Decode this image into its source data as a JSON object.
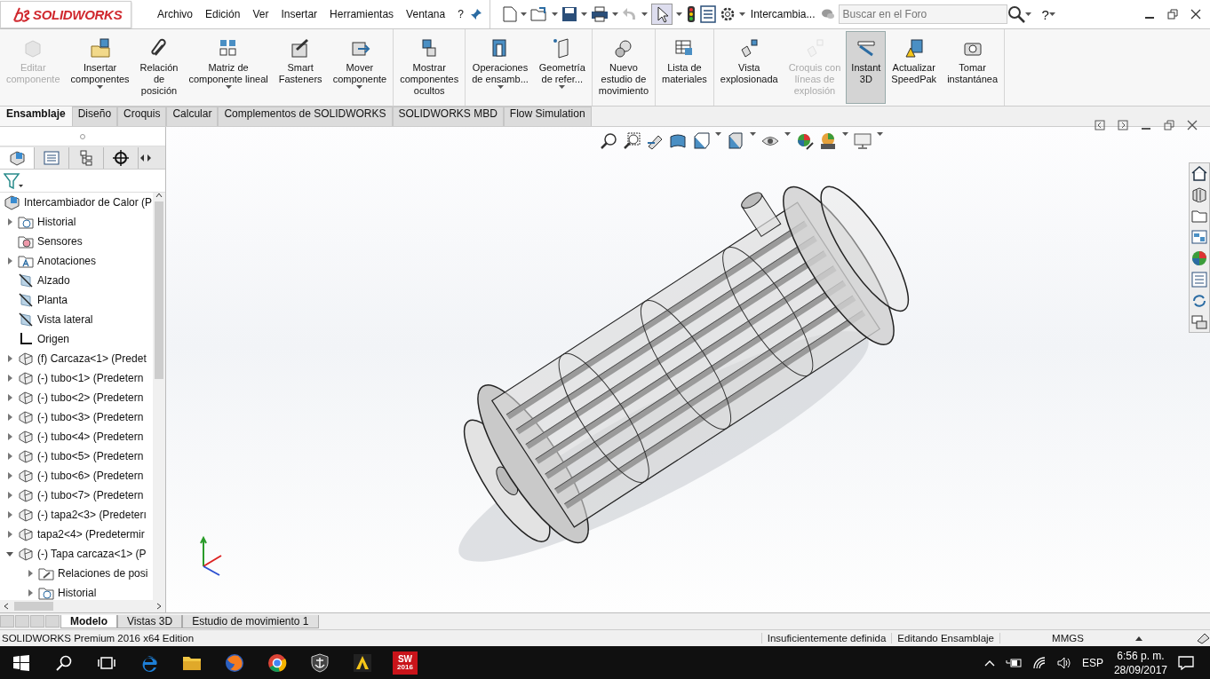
{
  "app": {
    "logo": "SOLIDWORKS",
    "menu": [
      "Archivo",
      "Edición",
      "Ver",
      "Insertar",
      "Herramientas",
      "Ventana",
      "?"
    ],
    "document_title": "Intercambia...",
    "search": {
      "placeholder": "Buscar en el Foro"
    },
    "help": "?"
  },
  "ribbon": {
    "groups": [
      [
        {
          "label": "Editar\ncomponente",
          "disabled": true,
          "selected": false,
          "dropdown": false
        },
        {
          "label": "Insertar\ncomponentes",
          "disabled": false,
          "selected": false,
          "dropdown": true
        },
        {
          "label": "Relación\nde\nposición",
          "disabled": false,
          "selected": false,
          "dropdown": false
        },
        {
          "label": "Matriz de\ncomponente lineal",
          "disabled": false,
          "selected": false,
          "dropdown": true
        },
        {
          "label": "Smart\nFasteners",
          "disabled": false,
          "selected": false,
          "dropdown": false
        },
        {
          "label": "Mover\ncomponente",
          "disabled": false,
          "selected": false,
          "dropdown": true
        }
      ],
      [
        {
          "label": "Mostrar\ncomponentes\nocultos",
          "disabled": false,
          "selected": false,
          "dropdown": false
        }
      ],
      [
        {
          "label": "Operaciones\nde ensamb...",
          "disabled": false,
          "selected": false,
          "dropdown": true
        },
        {
          "label": "Geometría\nde refer...",
          "disabled": false,
          "selected": false,
          "dropdown": true
        }
      ],
      [
        {
          "label": "Nuevo\nestudio de\nmovimiento",
          "disabled": false,
          "selected": false,
          "dropdown": false
        }
      ],
      [
        {
          "label": "Lista de\nmateriales",
          "disabled": false,
          "selected": false,
          "dropdown": false
        }
      ],
      [
        {
          "label": "Vista\nexplosionada",
          "disabled": false,
          "selected": false,
          "dropdown": false
        },
        {
          "label": "Croquis con\nlíneas de\nexplosión",
          "disabled": true,
          "selected": false,
          "dropdown": false
        },
        {
          "label": "Instant\n3D",
          "disabled": false,
          "selected": true,
          "dropdown": false
        },
        {
          "label": "Actualizar\nSpeedPak",
          "disabled": false,
          "selected": false,
          "dropdown": false
        },
        {
          "label": "Tomar\ninstantánea",
          "disabled": false,
          "selected": false,
          "dropdown": false
        }
      ]
    ]
  },
  "command_tabs": [
    {
      "label": "Ensamblaje",
      "selected": true
    },
    {
      "label": "Diseño",
      "selected": false
    },
    {
      "label": "Croquis",
      "selected": false
    },
    {
      "label": "Calcular",
      "selected": false
    },
    {
      "label": "Complementos de SOLIDWORKS",
      "selected": false
    },
    {
      "label": "SOLIDWORKS MBD",
      "selected": false
    },
    {
      "label": "Flow Simulation",
      "selected": false
    }
  ],
  "feature_tree": {
    "root": "Intercambiador de Calor  (P",
    "items": [
      {
        "label": "Historial",
        "kind": "history",
        "expanded": false
      },
      {
        "label": "Sensores",
        "kind": "sensor"
      },
      {
        "label": "Anotaciones",
        "kind": "annotation",
        "expanded": false
      },
      {
        "label": "Alzado",
        "kind": "plane"
      },
      {
        "label": "Planta",
        "kind": "plane"
      },
      {
        "label": "Vista lateral",
        "kind": "plane"
      },
      {
        "label": "Origen",
        "kind": "origin"
      },
      {
        "label": "(f) Carcaza<1> (Predet",
        "kind": "part",
        "expanded": false
      },
      {
        "label": "(-) tubo<1> (Predetern",
        "kind": "part",
        "expanded": false
      },
      {
        "label": "(-) tubo<2> (Predetern",
        "kind": "part",
        "expanded": false
      },
      {
        "label": "(-) tubo<3> (Predetern",
        "kind": "part",
        "expanded": false
      },
      {
        "label": "(-) tubo<4> (Predetern",
        "kind": "part",
        "expanded": false
      },
      {
        "label": "(-) tubo<5> (Predetern",
        "kind": "part",
        "expanded": false
      },
      {
        "label": "(-) tubo<6> (Predetern",
        "kind": "part",
        "expanded": false
      },
      {
        "label": "(-) tubo<7> (Predetern",
        "kind": "part",
        "expanded": false
      },
      {
        "label": "(-) tapa2<3> (Predeterı",
        "kind": "part",
        "expanded": false
      },
      {
        "label": "tapa2<4> (Predetermir",
        "kind": "part",
        "expanded": false
      },
      {
        "label": "(-) Tapa carcaza<1> (P",
        "kind": "part",
        "expanded": true,
        "children": [
          {
            "label": "Relaciones de posi",
            "kind": "mate",
            "expanded": false
          },
          {
            "label": "Historial",
            "kind": "history",
            "expanded": false
          }
        ]
      }
    ]
  },
  "bottom_tabs": [
    {
      "label": "Modelo",
      "selected": true
    },
    {
      "label": "Vistas 3D",
      "selected": false
    },
    {
      "label": "Estudio de movimiento 1",
      "selected": false
    }
  ],
  "status_bar": {
    "edition": "SOLIDWORKS Premium 2016 x64 Edition",
    "definition": "Insuficientemente definida",
    "mode": "Editando Ensamblaje",
    "units": "MMGS"
  },
  "taskbar": {
    "app_badge": [
      "SW",
      "2016"
    ],
    "language": "ESP",
    "time": "6:56 p. m.",
    "date": "28/09/2017"
  }
}
